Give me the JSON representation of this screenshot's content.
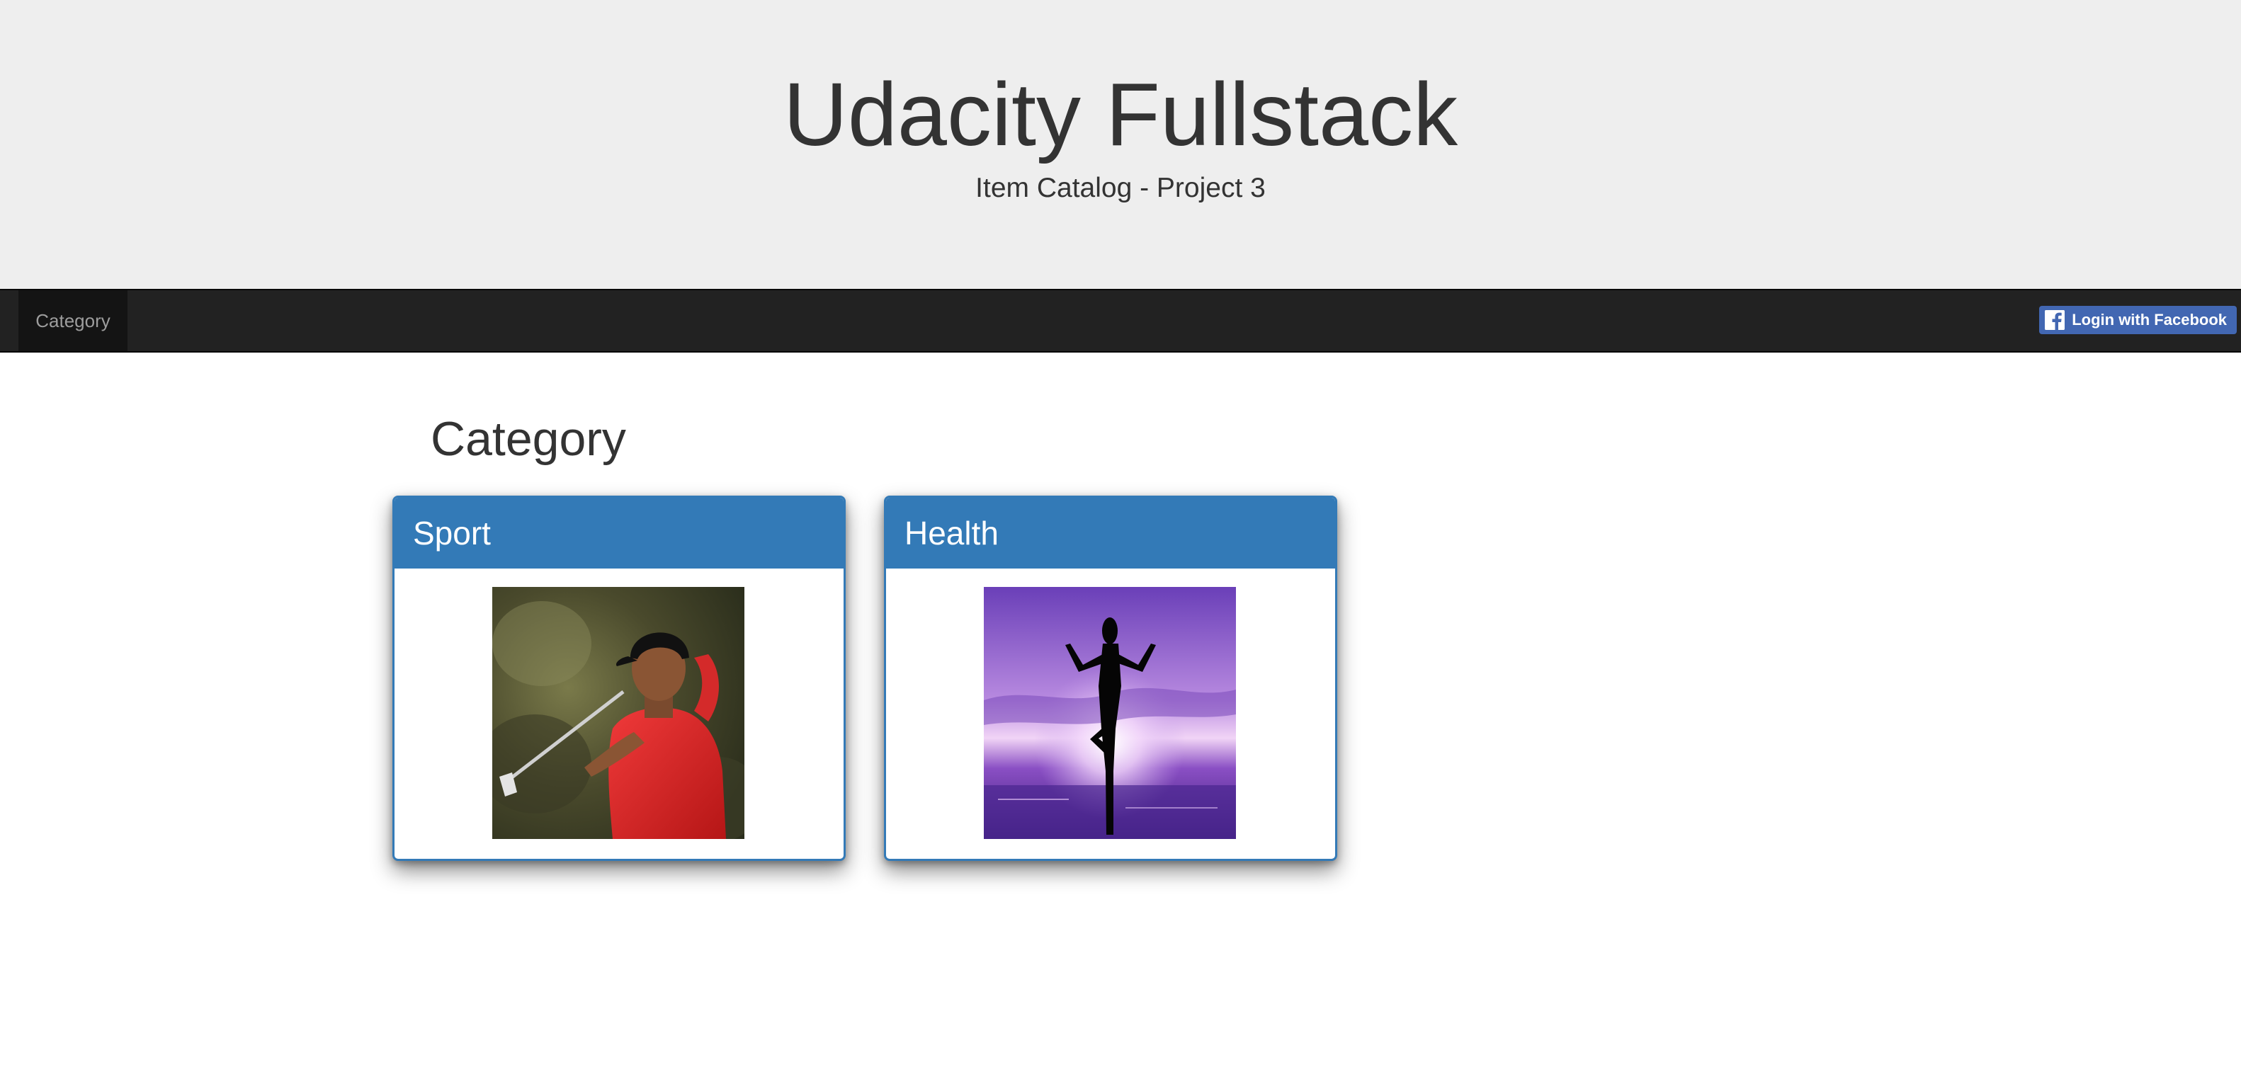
{
  "header": {
    "title": "Udacity Fullstack",
    "subtitle": "Item Catalog - Project 3"
  },
  "navbar": {
    "item_label": "Category",
    "login_label": "Login with Facebook",
    "login_icon": "facebook-icon",
    "login_color": "#4267b2"
  },
  "main": {
    "heading": "Category",
    "categories": [
      {
        "name": "Sport",
        "image": "golfer-photo"
      },
      {
        "name": "Health",
        "image": "yoga-silhouette-photo"
      }
    ]
  },
  "colors": {
    "primary": "#337ab7",
    "navbar": "#222222",
    "jumbotron": "#eeeeee"
  }
}
